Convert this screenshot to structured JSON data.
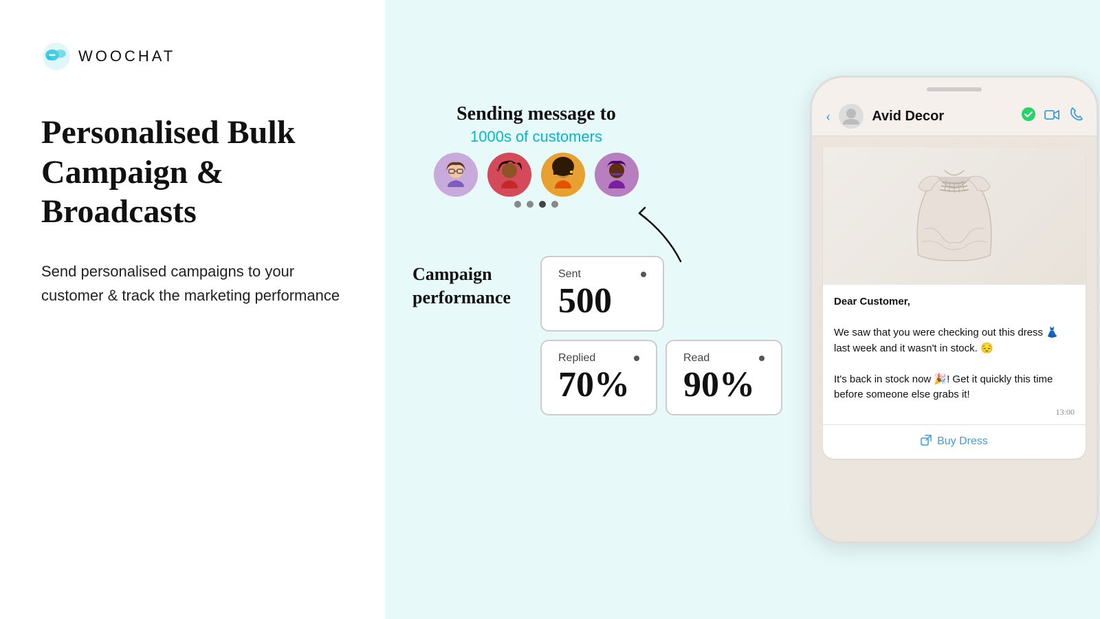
{
  "logo": {
    "text": "WOOCHAT"
  },
  "left": {
    "headline": "Personalised Bulk Campaign & Broadcasts",
    "description": "Send personalised campaigns to your customer & track the marketing performance"
  },
  "demo": {
    "sending_title": "Sending message to",
    "sending_subtitle": "1000s of customers",
    "avatars": [
      {
        "emoji": "🧑‍🎨",
        "bg": "#c9aadd"
      },
      {
        "emoji": "👩‍🦱",
        "bg": "#d44a5a"
      },
      {
        "emoji": "👩‍🦰",
        "bg": "#e8a030"
      },
      {
        "emoji": "👩",
        "bg": "#b87fc0"
      }
    ],
    "dots": [
      false,
      false,
      true,
      false
    ],
    "campaign_label": "Campaign performance",
    "stats": {
      "sent": {
        "label": "Sent",
        "value": "500"
      },
      "replied": {
        "label": "Replied",
        "value": "70%"
      },
      "read": {
        "label": "Read",
        "value": "90%"
      }
    }
  },
  "phone": {
    "contact_name": "Avid Decor",
    "message": {
      "salutation": "Dear Customer,",
      "line1": "We saw that you were checking out this dress 👗 last week and it wasn't in stock. 😔",
      "line2": "It's back in stock now 🎉! Get it quickly this time before someone else grabs it!",
      "time": "13:00",
      "buy_button": "Buy Dress"
    }
  },
  "icons": {
    "back": "‹",
    "verified": "✓",
    "video_call": "📹",
    "phone_call": "📞",
    "external_link": "↗"
  }
}
